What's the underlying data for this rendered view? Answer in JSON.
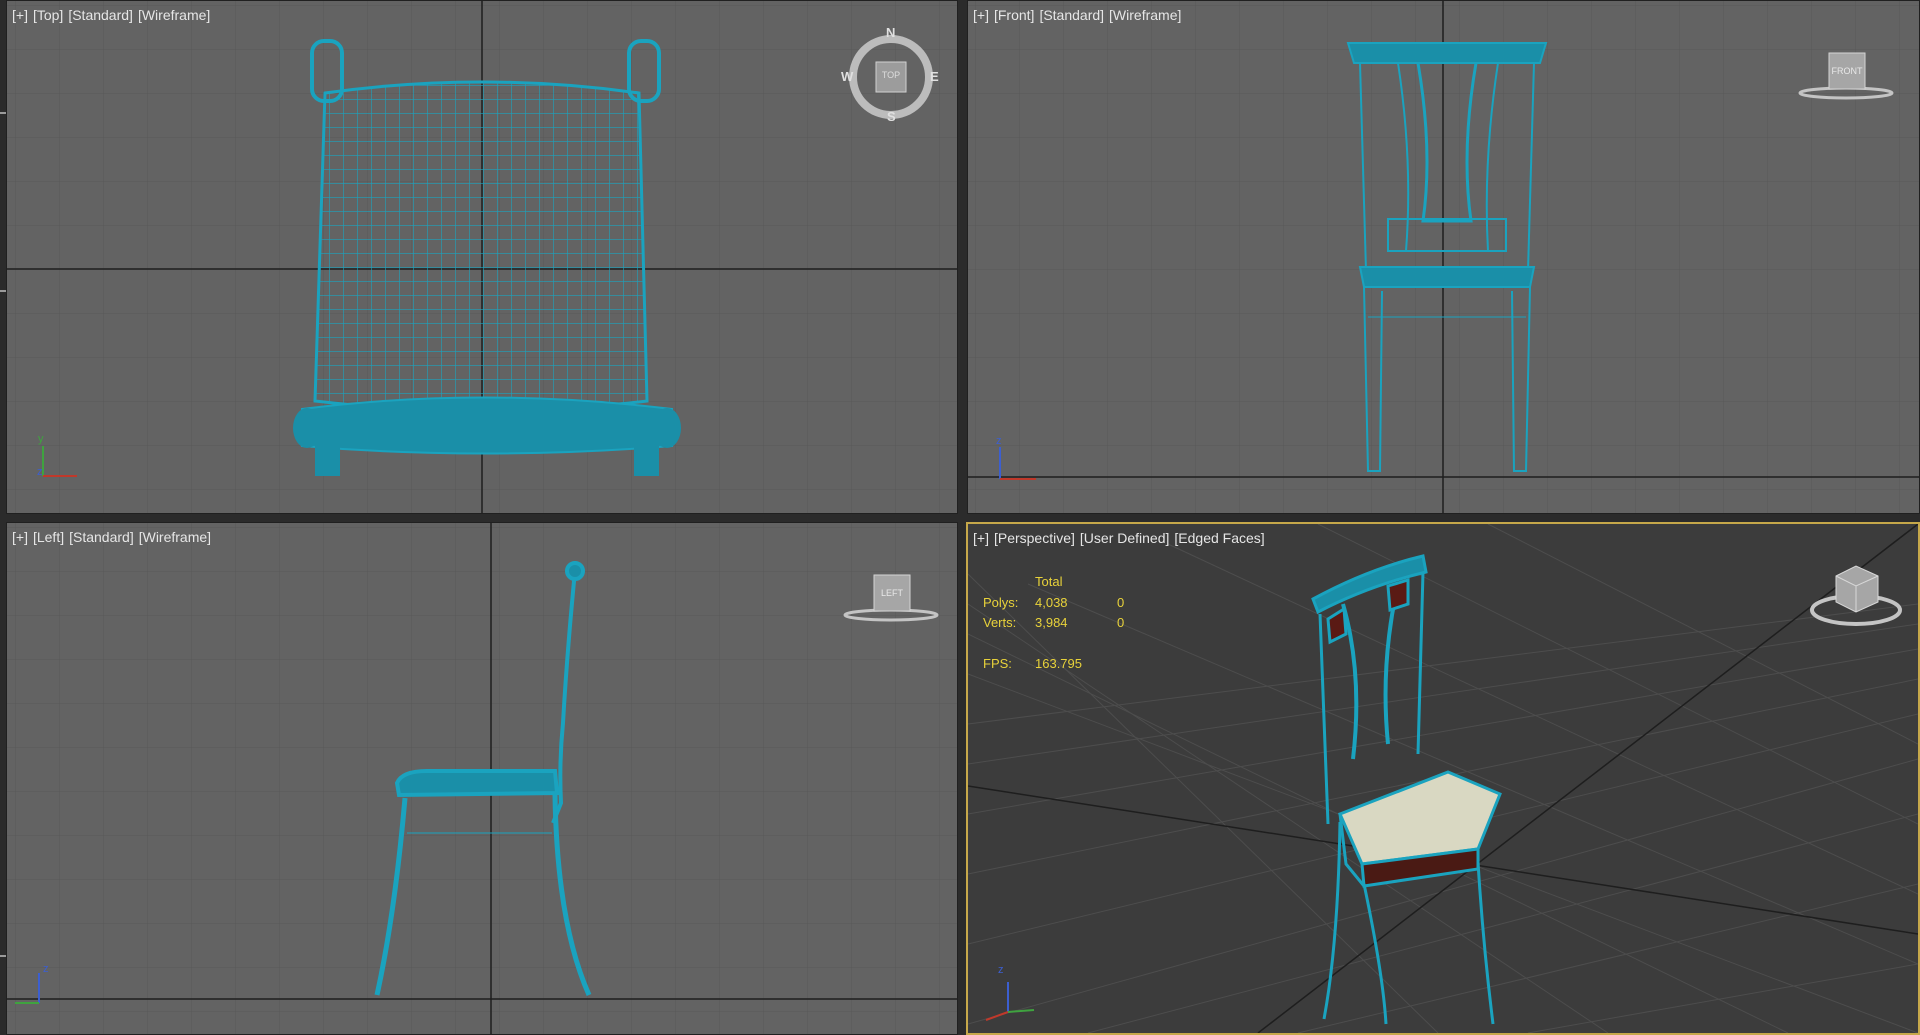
{
  "app": "3ds Max",
  "colors": {
    "wire": "#1aa3bf",
    "grid": "#555555",
    "axis": "#1e1e1e",
    "active_border": "#c6a84a",
    "stats_text": "#e8d23a",
    "bg_ortho": "#636363",
    "bg_persp": "#3c3c3c"
  },
  "viewports": {
    "top": {
      "menu": "[+]",
      "view": "[Top]",
      "shading": "[Standard]",
      "mode": "[Wireframe]",
      "gizmo": {
        "top": "TOP",
        "n": "N",
        "s": "S",
        "e": "E",
        "w": "W"
      },
      "axis_y": "y",
      "axis_x": "x",
      "axis_z": "z"
    },
    "front": {
      "menu": "[+]",
      "view": "[Front]",
      "shading": "[Standard]",
      "mode": "[Wireframe]",
      "gizmo": "FRONT",
      "axis_z": "z",
      "axis_x": "x"
    },
    "left": {
      "menu": "[+]",
      "view": "[Left]",
      "shading": "[Standard]",
      "mode": "[Wireframe]",
      "gizmo": "LEFT",
      "axis_z": "z",
      "axis_y": "y"
    },
    "perspective": {
      "menu": "[+]",
      "view": "[Perspective]",
      "shading": "[User Defined]",
      "mode": "[Edged Faces]",
      "axis_z": "z",
      "axis_x": "x",
      "axis_y": "y",
      "stats": {
        "header": "Total",
        "polys_label": "Polys:",
        "polys_total": "4,038",
        "polys_sel": "0",
        "verts_label": "Verts:",
        "verts_total": "3,984",
        "verts_sel": "0",
        "fps_label": "FPS:",
        "fps_value": "163.795"
      }
    }
  }
}
